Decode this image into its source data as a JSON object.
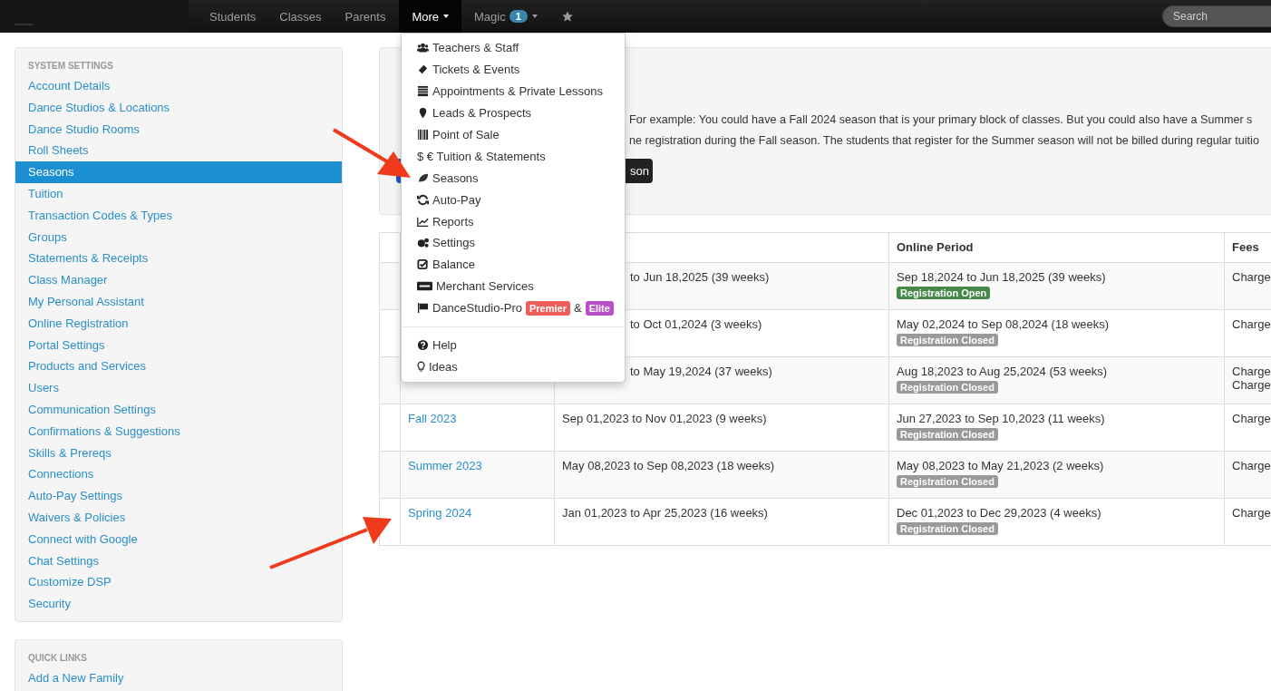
{
  "nav": {
    "items": [
      {
        "label": "Students",
        "selected": false
      },
      {
        "label": "Classes",
        "selected": false
      },
      {
        "label": "Parents",
        "selected": false
      },
      {
        "label": "More",
        "selected": true
      }
    ],
    "magic": {
      "label": "Magic",
      "badge": "1"
    },
    "search": {
      "placeholder": "Search"
    }
  },
  "dropdown": {
    "items": [
      {
        "label": "Teachers & Staff"
      },
      {
        "label": "Tickets & Events"
      },
      {
        "label": "Appointments & Private Lessons"
      },
      {
        "label": "Leads & Prospects"
      },
      {
        "label": "Point of Sale"
      },
      {
        "label": "$ € Tuition & Statements"
      },
      {
        "label": "Seasons"
      },
      {
        "label": "Auto-Pay"
      },
      {
        "label": "Reports"
      },
      {
        "label": "Settings"
      },
      {
        "label": "Balance"
      },
      {
        "label": "Merchant Services"
      },
      {
        "label": "DanceStudio-Pro",
        "badges": [
          {
            "label": "Premier",
            "color": "#ee5f5b"
          },
          {
            "label": "Elite",
            "color": "#b94fc6"
          }
        ],
        "joiner": "&"
      }
    ],
    "footer_items": [
      {
        "label": "Help"
      },
      {
        "label": "Ideas"
      }
    ]
  },
  "sidebar": {
    "heading": "SYSTEM SETTINGS",
    "items": [
      {
        "label": "Account Details",
        "selected": false
      },
      {
        "label": "Dance Studios & Locations",
        "selected": false
      },
      {
        "label": "Dance Studio Rooms",
        "selected": false
      },
      {
        "label": "Roll Sheets",
        "selected": false
      },
      {
        "label": "Seasons",
        "selected": true
      },
      {
        "label": "Tuition",
        "selected": false
      },
      {
        "label": "Transaction Codes & Types",
        "selected": false
      },
      {
        "label": "Groups",
        "selected": false
      },
      {
        "label": "Statements & Receipts",
        "selected": false
      },
      {
        "label": "Class Manager",
        "selected": false
      },
      {
        "label": "My Personal Assistant",
        "selected": false
      },
      {
        "label": "Online Registration",
        "selected": false
      },
      {
        "label": "Portal Settings",
        "selected": false
      },
      {
        "label": "Products and Services",
        "selected": false
      },
      {
        "label": "Users",
        "selected": false
      },
      {
        "label": "Communication Settings",
        "selected": false
      },
      {
        "label": "Confirmations & Suggestions",
        "selected": false
      },
      {
        "label": "Skills & Prereqs",
        "selected": false
      },
      {
        "label": "Connections",
        "selected": false
      },
      {
        "label": "Auto-Pay Settings",
        "selected": false
      },
      {
        "label": "Waivers & Policies",
        "selected": false
      },
      {
        "label": "Connect with Google",
        "selected": false
      },
      {
        "label": "Chat Settings",
        "selected": false
      },
      {
        "label": "Customize DSP",
        "selected": false
      },
      {
        "label": "Security",
        "selected": false
      }
    ]
  },
  "quick_links": {
    "heading": "QUICK LINKS",
    "items": [
      "Add a New Family"
    ]
  },
  "page": {
    "description": [
      {
        "rest": "For example: You could have a Fall 2024 season that is your primary block of classes. But you could also have a Summer s"
      },
      {
        "rest": "ne registration during the Fall season. The students that register for the Summer season will not be billed during regular tuitio"
      }
    ],
    "button": "son",
    "table": {
      "columns": [
        "Online Period",
        "Fees"
      ],
      "rows": [
        {
          "name": "",
          "period": "to Jun 18,2025 (39 weeks)",
          "online": "Sep 18,2024 to Jun 18,2025 (39 weeks)",
          "status": {
            "label": "Registration Open",
            "color": "#468847"
          },
          "fees": [
            "Charge"
          ]
        },
        {
          "name": "",
          "period": "to Oct 01,2024 (3 weeks)",
          "online": "May 02,2024 to Sep 08,2024 (18 weeks)",
          "status": {
            "label": "Registration Closed",
            "color": "#999999"
          },
          "fees": [
            "Charge"
          ]
        },
        {
          "name": "",
          "period": "to May 19,2024 (37 weeks)",
          "online": "Aug 18,2023 to Aug 25,2024 (53 weeks)",
          "status": {
            "label": "Registration Closed",
            "color": "#999999"
          },
          "fees": [
            "Charge",
            "Charge"
          ]
        },
        {
          "name": "Fall 2023",
          "period": "Sep 01,2023 to Nov 01,2023 (9 weeks)",
          "online": "Jun 27,2023 to Sep 10,2023 (11 weeks)",
          "status": {
            "label": "Registration Closed",
            "color": "#999999"
          },
          "fees": [
            "Charge"
          ]
        },
        {
          "name": "Summer 2023",
          "period": "May 08,2023 to Sep 08,2023 (18 weeks)",
          "online": "May 08,2023 to May 21,2023 (2 weeks)",
          "status": {
            "label": "Registration Closed",
            "color": "#999999"
          },
          "fees": [
            "Charge"
          ]
        },
        {
          "name": "Spring 2024",
          "period": "Jan 01,2023 to Apr 25,2023 (16 weeks)",
          "online": "Dec 01,2023 to Dec 29,2023 (4 weeks)",
          "status": {
            "label": "Registration Closed",
            "color": "#999999"
          },
          "fees": [
            "Charge"
          ]
        }
      ]
    }
  }
}
